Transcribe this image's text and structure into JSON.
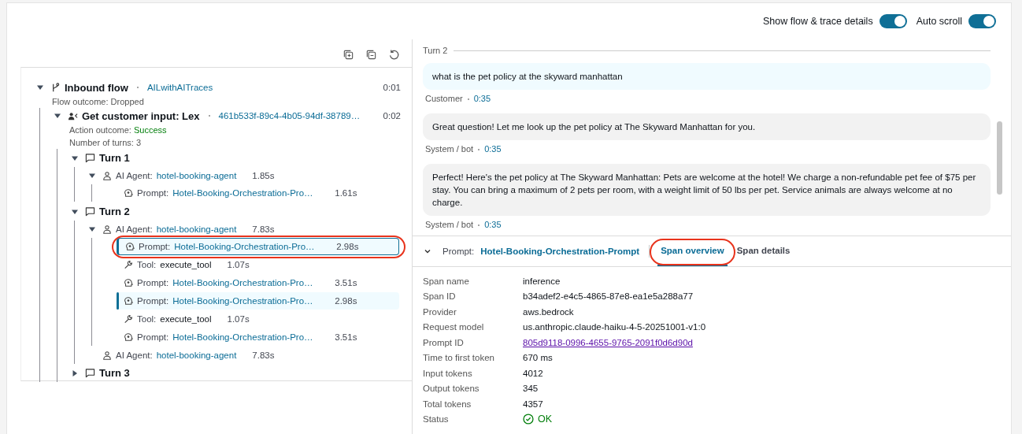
{
  "header": {
    "toggles": [
      {
        "label": "Show flow & trace details",
        "on": true
      },
      {
        "label": "Auto scroll",
        "on": true
      }
    ]
  },
  "tree": {
    "toolbar": [
      {
        "kind": "expand"
      },
      {
        "kind": "collapse"
      },
      {
        "kind": "refresh"
      }
    ],
    "nodes": [
      {
        "kind": "flow",
        "expanded": true,
        "title": "Inbound flow",
        "link": "AILwithAITraces",
        "time": "0:01",
        "details": [
          {
            "label": "Flow outcome:",
            "value": "Dropped",
            "positive": false
          }
        ],
        "children": [
          {
            "kind": "action",
            "expanded": true,
            "title": "Get customer input: Lex",
            "link": "461b533f-89c4-4b05-94df-38789…",
            "time": "0:02",
            "details": [
              {
                "label": "Action outcome:",
                "value": "Success",
                "positive": true
              },
              {
                "label": "Number of turns:",
                "value": "3",
                "positive": false
              }
            ],
            "children": [
              {
                "kind": "turn",
                "expanded": true,
                "title": "Turn 1",
                "children": [
                  {
                    "kind": "agent",
                    "expanded": true,
                    "label": "AI Agent:",
                    "link": "hotel-booking-agent",
                    "time": "1.85s",
                    "children": [
                      {
                        "kind": "prompt",
                        "label": "Prompt:",
                        "link": "Hotel-Booking-Orchestration-Pro…",
                        "time": "1.61s",
                        "selected": false,
                        "highlighted": false,
                        "circled": false
                      }
                    ]
                  }
                ]
              },
              {
                "kind": "turn",
                "expanded": true,
                "title": "Turn 2",
                "children": [
                  {
                    "kind": "agent",
                    "expanded": true,
                    "label": "AI Agent:",
                    "link": "hotel-booking-agent",
                    "time": "7.83s",
                    "children": [
                      {
                        "kind": "prompt",
                        "label": "Prompt:",
                        "link": "Hotel-Booking-Orchestration-Pro…",
                        "time": "2.98s",
                        "selected": true,
                        "highlighted": false,
                        "circled": true
                      },
                      {
                        "kind": "tool",
                        "label": "Tool:",
                        "link": "execute_tool",
                        "time": "1.07s",
                        "selected": false,
                        "highlighted": false,
                        "circled": false
                      },
                      {
                        "kind": "prompt",
                        "label": "Prompt:",
                        "link": "Hotel-Booking-Orchestration-Pro…",
                        "time": "3.51s",
                        "selected": false,
                        "highlighted": false,
                        "circled": false
                      },
                      {
                        "kind": "prompt",
                        "label": "Prompt:",
                        "link": "Hotel-Booking-Orchestration-Pro…",
                        "time": "2.98s",
                        "selected": false,
                        "highlighted": true,
                        "circled": false
                      },
                      {
                        "kind": "tool",
                        "label": "Tool:",
                        "link": "execute_tool",
                        "time": "1.07s",
                        "selected": false,
                        "highlighted": false,
                        "circled": false
                      },
                      {
                        "kind": "prompt",
                        "label": "Prompt:",
                        "link": "Hotel-Booking-Orchestration-Pro…",
                        "time": "3.51s",
                        "selected": false,
                        "highlighted": false,
                        "circled": false
                      }
                    ]
                  },
                  {
                    "kind": "agent",
                    "label": "AI Agent:",
                    "link": "hotel-booking-agent",
                    "time": "7.83s"
                  }
                ]
              },
              {
                "kind": "turn",
                "expanded": false,
                "title": "Turn 3"
              }
            ]
          }
        ]
      }
    ]
  },
  "transcript": {
    "turn_label": "Turn 2",
    "messages": [
      {
        "kind": "customer",
        "text": "what is the pet policy at the skyward manhattan",
        "speaker": "Customer",
        "time": "0:35"
      },
      {
        "kind": "bot",
        "text": "Great question! Let me look up the pet policy at The Skyward Manhattan for you.",
        "speaker": "System / bot",
        "time": "0:35"
      },
      {
        "kind": "bot",
        "text": "Perfect! Here's the pet policy at The Skyward Manhattan: Pets are welcome at the hotel! We charge a non-refundable pet fee of $75 per stay. You can bring a maximum of 2 pets per room, with a weight limit of 50 lbs per pet. Service animals are always welcome at no charge.",
        "speaker": "System / bot",
        "time": "0:35"
      }
    ]
  },
  "span": {
    "expanded": true,
    "label": "Prompt:",
    "name": "Hotel-Booking-Orchestration-Prompt",
    "tabs": [
      {
        "label": "Span overview",
        "selected": true,
        "circled": true
      },
      {
        "label": "Span details",
        "selected": false,
        "circled": false
      }
    ],
    "fields": [
      {
        "kind": "text",
        "label": "Span name",
        "value": "inference"
      },
      {
        "kind": "text",
        "label": "Span ID",
        "value": "b34adef2-e4c5-4865-87e8-ea1e5a288a77"
      },
      {
        "kind": "text",
        "label": "Provider",
        "value": "aws.bedrock"
      },
      {
        "kind": "text",
        "label": "Request model",
        "value": "us.anthropic.claude-haiku-4-5-20251001-v1:0"
      },
      {
        "kind": "link",
        "label": "Prompt ID",
        "value": "805d9118-0996-4655-9765-2091f0d6d90d"
      },
      {
        "kind": "text",
        "label": "Time to first token",
        "value": "670 ms"
      },
      {
        "kind": "text",
        "label": "Input tokens",
        "value": "4012"
      },
      {
        "kind": "text",
        "label": "Output tokens",
        "value": "345"
      },
      {
        "kind": "text",
        "label": "Total tokens",
        "value": "4357"
      },
      {
        "kind": "status",
        "label": "Status",
        "value": "OK"
      }
    ]
  }
}
